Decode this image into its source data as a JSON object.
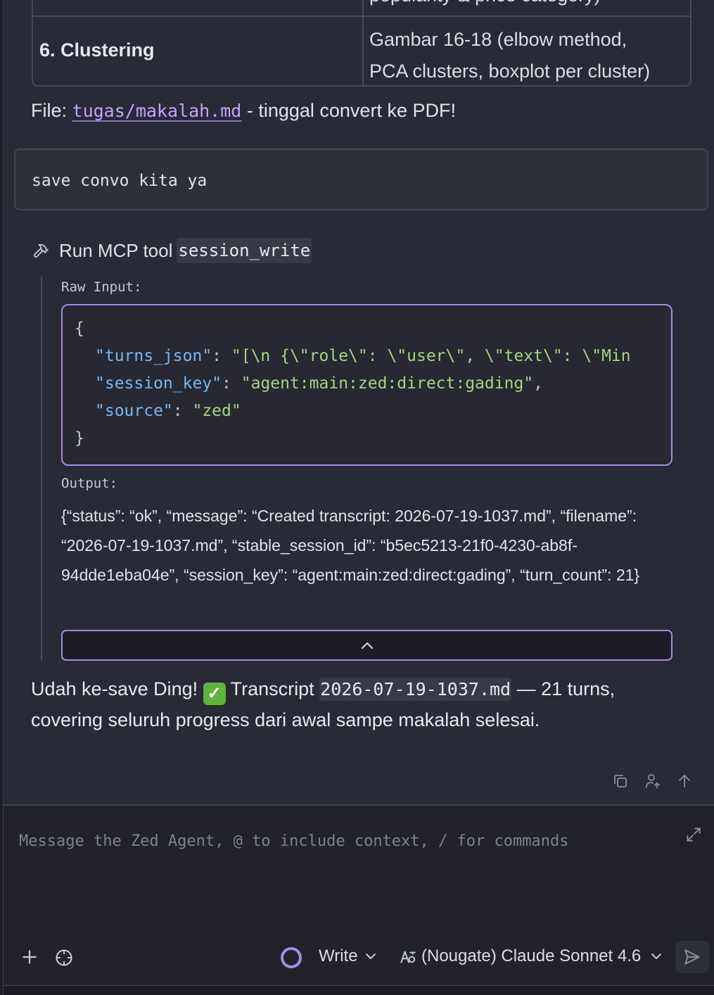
{
  "table": {
    "prev_cell_text": "popularity & price category)",
    "row_label": "6. Clustering",
    "row_value_line1": "Gambar 16-18 (elbow method,",
    "row_value_line2": "PCA clusters, boxplot per cluster)"
  },
  "file_line": {
    "prefix": "File: ",
    "link": "tugas/makalah.md",
    "suffix": " - tinggal convert ke PDF!"
  },
  "user_message": "save convo kita ya",
  "tool_call": {
    "label": "Run MCP tool",
    "name": "session_write",
    "raw_input_label": "Raw Input:",
    "code": {
      "open_brace": "{",
      "close_brace": "}",
      "k1": "\"turns_json\"",
      "v1": "\"[\\n  {\\\"role\\\": \\\"user\\\", \\\"text\\\": \\\"Min",
      "k2": "\"session_key\"",
      "v2": "\"agent:main:zed:direct:gading\"",
      "k3": "\"source\"",
      "v3": "\"zed\""
    },
    "output_label": "Output:",
    "output_text": "{“status”: “ok”, “message”: “Created transcript: 2026-07-19-1037.md”, “filename”: “2026-07-19-1037.md”, “stable_session_id”: “b5ec5213-21f0-4230-ab8f-94dde1eba04e”, “session_key”: “agent:main:zed:direct:gading”, “turn_count”: 21}"
  },
  "reply": {
    "part1": "Udah ke-save Ding! ",
    "check_icon": "check-mark-emoji",
    "part2": " Transcript ",
    "code": "2026-07-19-1037.md",
    "part3": " — 21 turns, covering seluruh progress dari awal sampe makalah selesai."
  },
  "composer": {
    "placeholder": "Message the Zed Agent, @ to include context, / for commands",
    "mode": "Write",
    "model": "(Nougate) Claude Sonnet 4.6"
  },
  "colors": {
    "background": "#282a35",
    "accent": "#a88bdf",
    "link": "#c5a3ff",
    "json_key": "#7db7ee",
    "json_string": "#a6d482"
  }
}
